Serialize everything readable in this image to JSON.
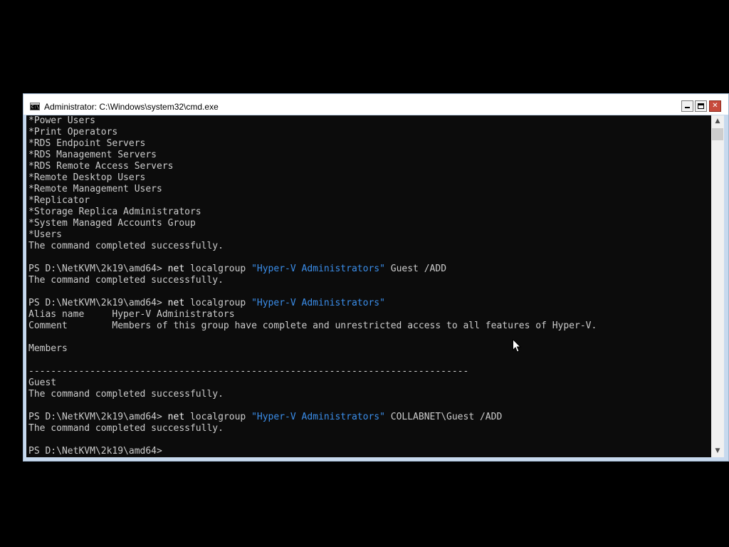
{
  "window": {
    "title": "Administrator: C:\\Windows\\system32\\cmd.exe",
    "icon_text": "C:\\",
    "minimize_icon": "minimize-icon",
    "maximize_icon": "maximize-icon",
    "close_icon": "close-icon",
    "close_glyph": "✕"
  },
  "colors": {
    "console_background": "#0c0c0c",
    "console_text": "#cccccc",
    "command_word": "#f2f2f2",
    "command_string": "#3b8eea",
    "close_button": "#c74b3d"
  },
  "console": {
    "lines": [
      "*Power Users",
      "*Print Operators",
      "*RDS Endpoint Servers",
      "*RDS Management Servers",
      "*RDS Remote Access Servers",
      "*Remote Desktop Users",
      "*Remote Management Users",
      "*Replicator",
      "*Storage Replica Administrators",
      "*System Managed Accounts Group",
      "*Users",
      "The command completed successfully.",
      "",
      "",
      "The command completed successfully.",
      "",
      "",
      "Alias name     Hyper-V Administrators",
      "Comment        Members of this group have complete and unrestricted access to all features of Hyper-V.",
      "",
      "Members",
      "",
      "-------------------------------------------------------------------------------",
      "Guest",
      "The command completed successfully.",
      "",
      "",
      "The command completed successfully.",
      "",
      ""
    ],
    "commands": [
      {
        "prompt": "PS D:\\NetKVM\\2k19\\amd64> ",
        "word": "net",
        "arg1": " localgroup ",
        "string": "\"Hyper-V Administrators\"",
        "rest": " Guest /ADD"
      },
      {
        "prompt": "PS D:\\NetKVM\\2k19\\amd64> ",
        "word": "net",
        "arg1": " localgroup ",
        "string": "\"Hyper-V Administrators\"",
        "rest": ""
      },
      {
        "prompt": "PS D:\\NetKVM\\2k19\\amd64> ",
        "word": "net",
        "arg1": " localgroup ",
        "string": "\"Hyper-V Administrators\"",
        "rest": " COLLABNET\\Guest /ADD"
      }
    ],
    "final_prompt": "PS D:\\NetKVM\\2k19\\amd64>"
  },
  "scrollbar": {
    "up_arrow_icon": "scroll-up-arrow-icon",
    "down_arrow_icon": "scroll-down-arrow-icon",
    "up_glyph": "▲",
    "down_glyph": "▼"
  },
  "pointer": {
    "icon": "mouse-cursor-icon"
  }
}
